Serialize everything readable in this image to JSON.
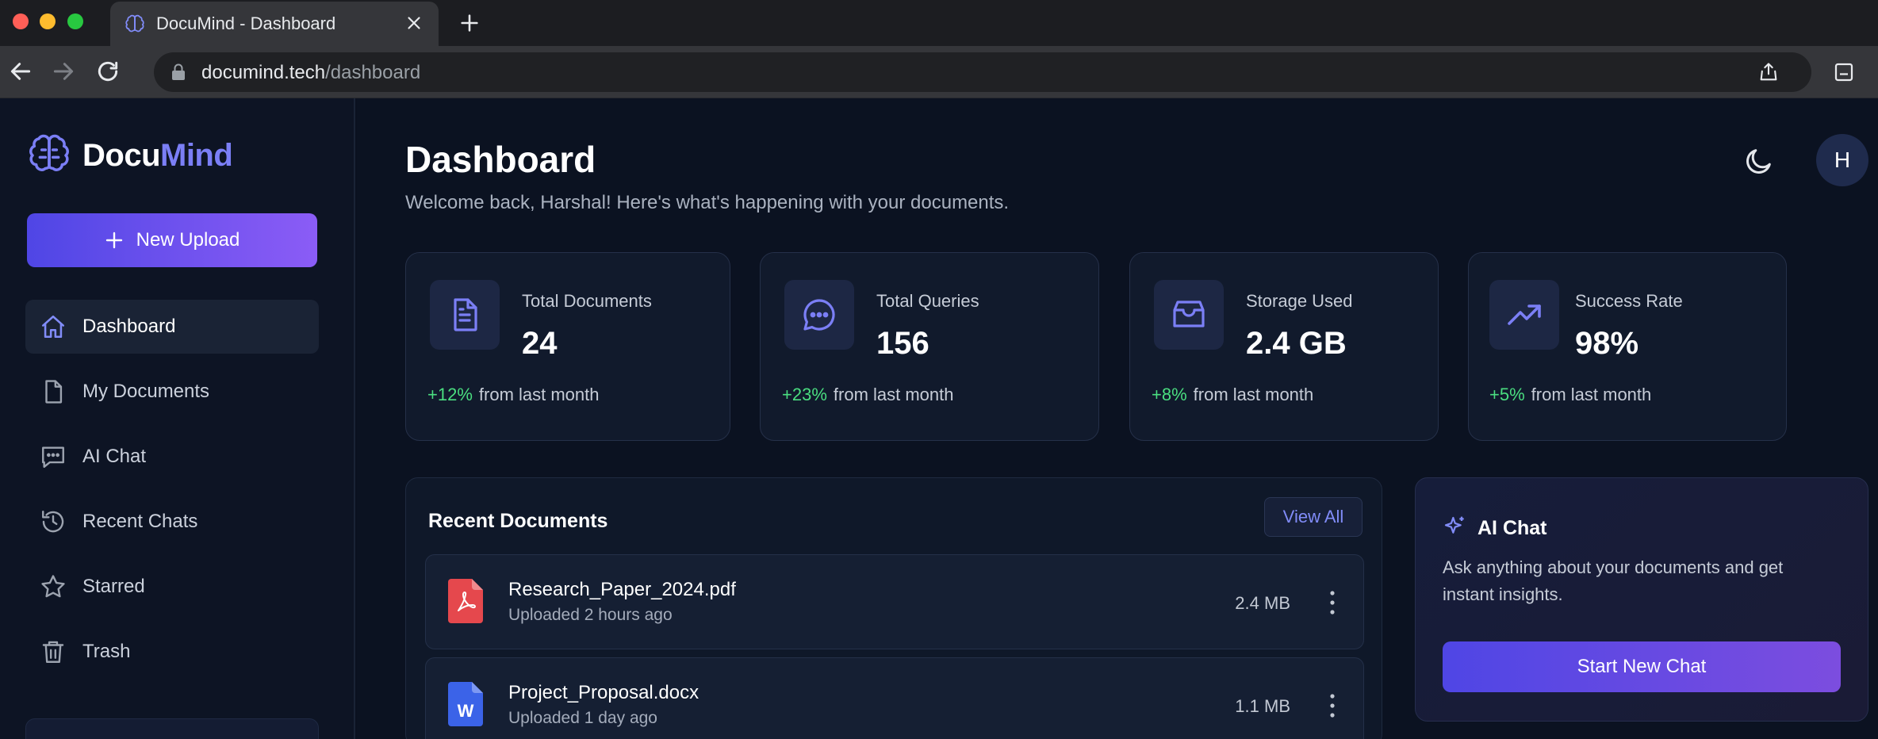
{
  "browser": {
    "tab_title": "DocuMind - Dashboard",
    "url_host": "documind.tech",
    "url_path": "/dashboard"
  },
  "sidebar": {
    "logo_prefix": "Docu",
    "logo_accent": "Mind",
    "new_upload_label": "New Upload",
    "items": [
      {
        "label": "Dashboard",
        "icon": "home-icon",
        "active": true
      },
      {
        "label": "My Documents",
        "icon": "file-icon",
        "active": false
      },
      {
        "label": "AI Chat",
        "icon": "chat-icon",
        "active": false
      },
      {
        "label": "Recent Chats",
        "icon": "history-icon",
        "active": false
      },
      {
        "label": "Starred",
        "icon": "star-icon",
        "active": false
      },
      {
        "label": "Trash",
        "icon": "trash-icon",
        "active": false
      }
    ]
  },
  "header": {
    "title": "Dashboard",
    "subtitle": "Welcome back, Harshal! Here's what's happening with your documents.",
    "avatar_initial": "H"
  },
  "stats": [
    {
      "label": "Total Documents",
      "value": "24",
      "change": "+12%",
      "change_suffix": "from last month",
      "icon": "document-icon"
    },
    {
      "label": "Total Queries",
      "value": "156",
      "change": "+23%",
      "change_suffix": "from last month",
      "icon": "message-icon"
    },
    {
      "label": "Storage Used",
      "value": "2.4 GB",
      "change": "+8%",
      "change_suffix": "from last month",
      "icon": "storage-icon"
    },
    {
      "label": "Success Rate",
      "value": "98%",
      "change": "+5%",
      "change_suffix": "from last month",
      "icon": "trending-up-icon"
    }
  ],
  "recent_documents": {
    "title": "Recent Documents",
    "view_all_label": "View All",
    "items": [
      {
        "name": "Research_Paper_2024.pdf",
        "uploaded": "Uploaded 2 hours ago",
        "size": "2.4 MB",
        "type": "pdf"
      },
      {
        "name": "Project_Proposal.docx",
        "uploaded": "Uploaded 1 day ago",
        "size": "1.1 MB",
        "type": "docx"
      }
    ]
  },
  "ai_chat_card": {
    "title": "AI Chat",
    "description": "Ask anything about your documents and get instant insights.",
    "button_label": "Start New Chat"
  },
  "colors": {
    "accent": "#7b7ff6",
    "positive": "#4ade80",
    "pdf": "#e5484d",
    "docx": "#3b63e8"
  }
}
